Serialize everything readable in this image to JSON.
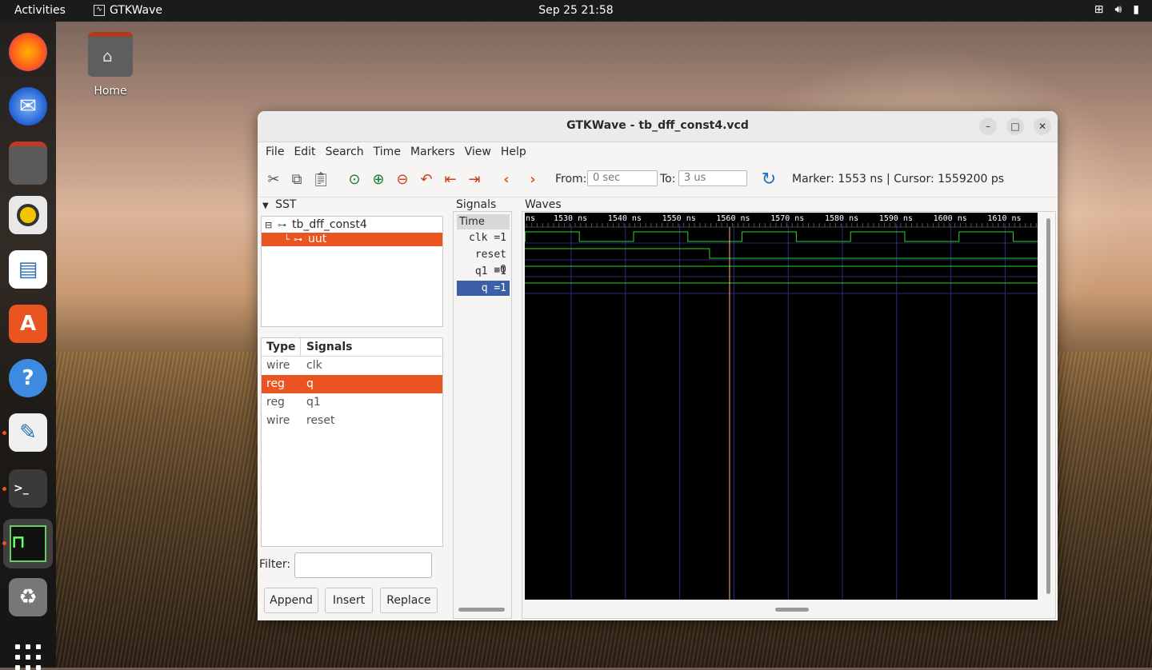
{
  "topbar": {
    "activities": "Activities",
    "app_name": "GTKWave",
    "clock": "Sep 25  21:58"
  },
  "desktop": {
    "home_label": "Home"
  },
  "window": {
    "title": "GTKWave - tb_dff_const4.vcd",
    "menu": [
      "File",
      "Edit",
      "Search",
      "Time",
      "Markers",
      "View",
      "Help"
    ],
    "toolbar": {
      "from_label": "From:",
      "from_value": "0 sec",
      "to_label": "To:",
      "to_value": "3 us",
      "marker_text": "Marker: 1553 ns  |  Cursor: 1559200 ps"
    },
    "sst": {
      "label": "SST",
      "tree": [
        {
          "label": "tb_dff_const4",
          "selected": false
        },
        {
          "label": "uut",
          "selected": true
        }
      ],
      "columns": [
        "Type",
        "Signals"
      ],
      "rows": [
        {
          "type": "wire",
          "name": "clk",
          "selected": false
        },
        {
          "type": "reg",
          "name": "q",
          "selected": true
        },
        {
          "type": "reg",
          "name": "q1",
          "selected": false
        },
        {
          "type": "wire",
          "name": "reset",
          "selected": false
        }
      ],
      "filter_label": "Filter:",
      "buttons": [
        "Append",
        "Insert",
        "Replace"
      ]
    },
    "signals": {
      "label": "Signals",
      "time_label": "Time",
      "rows": [
        "clk =1",
        "reset =0",
        "q1 =1",
        "q =1"
      ]
    },
    "waves": {
      "label": "Waves",
      "ruler_ticks": [
        "ns",
        "1530 ns",
        "1540 ns",
        "1550 ns",
        "1560 ns",
        "1570 ns",
        "1580 ns",
        "1590 ns",
        "1600 ns",
        "1610 ns"
      ],
      "marker_ns": 1553,
      "cursor_ns": 1559.2
    }
  }
}
